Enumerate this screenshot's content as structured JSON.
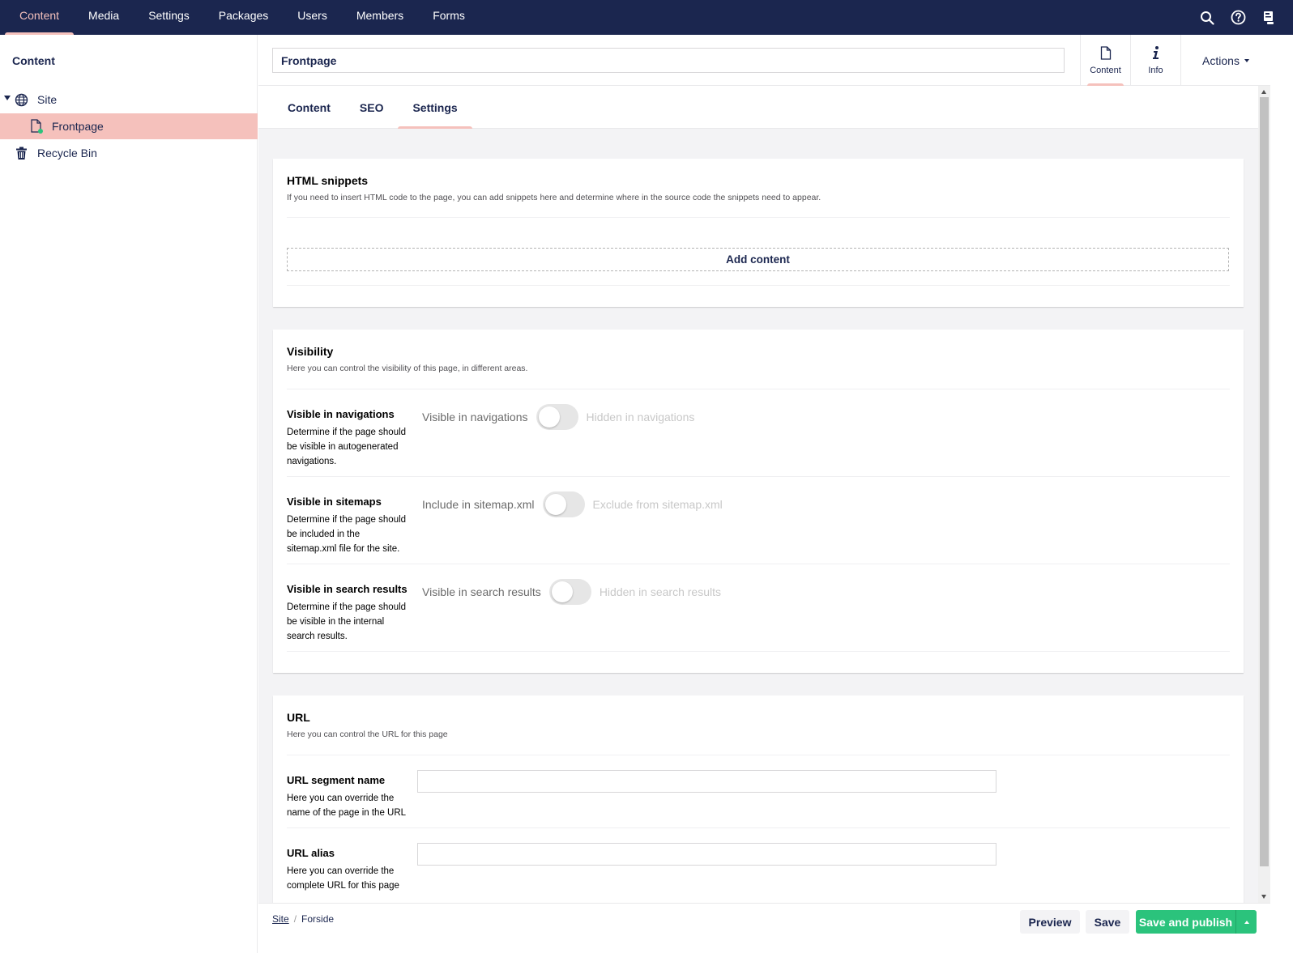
{
  "topnav": {
    "items": [
      {
        "label": "Content",
        "active": true
      },
      {
        "label": "Media"
      },
      {
        "label": "Settings"
      },
      {
        "label": "Packages"
      },
      {
        "label": "Users"
      },
      {
        "label": "Members"
      },
      {
        "label": "Forms"
      }
    ],
    "icons": [
      "search-icon",
      "help-icon",
      "user-avatar-icon"
    ]
  },
  "sidebar": {
    "title": "Content",
    "tree": [
      {
        "label": "Site",
        "icon": "globe-icon",
        "expanded": true
      },
      {
        "label": "Frontpage",
        "icon": "document-icon",
        "selected": true
      },
      {
        "label": "Recycle Bin",
        "icon": "trash-icon"
      }
    ]
  },
  "header": {
    "name_value": "Frontpage",
    "apps": [
      {
        "label": "Content",
        "icon": "document-icon",
        "active": true
      },
      {
        "label": "Info",
        "icon": "info-icon"
      }
    ],
    "actions_label": "Actions"
  },
  "tabs": [
    {
      "label": "Content"
    },
    {
      "label": "SEO"
    },
    {
      "label": "Settings",
      "active": true
    }
  ],
  "panels": {
    "html_snippets": {
      "title": "HTML snippets",
      "description": "If you need to insert HTML code to the page, you can add snippets here and determine where in the source code the snippets need to appear.",
      "add_content_label": "Add content"
    },
    "visibility": {
      "title": "Visibility",
      "description": "Here you can control the visibility of this page, in different areas.",
      "properties": [
        {
          "label": "Visible in navigations",
          "description": "Determine if the page should be visible in autogenerated navigations.",
          "on_label": "Visible in navigations",
          "off_label": "Hidden in navigations",
          "value": false
        },
        {
          "label": "Visible in sitemaps",
          "description": "Determine if the page should be included in the sitemap.xml file for the site.",
          "on_label": "Include in sitemap.xml",
          "off_label": "Exclude from sitemap.xml",
          "value": false
        },
        {
          "label": "Visible in search results",
          "description": "Determine if the page should be visible in the internal search results.",
          "on_label": "Visible in search results",
          "off_label": "Hidden in search results",
          "value": false
        }
      ]
    },
    "url": {
      "title": "URL",
      "description": "Here you can control the URL for this page",
      "properties": [
        {
          "label": "URL segment name",
          "description": "Here you can override the name of the page in the URL",
          "value": ""
        },
        {
          "label": "URL alias",
          "description": "Here you can override the complete URL for this page",
          "value": ""
        }
      ]
    }
  },
  "footer": {
    "breadcrumb": [
      "Site",
      "Forside"
    ],
    "preview_label": "Preview",
    "save_label": "Save",
    "publish_label": "Save and publish"
  },
  "colors": {
    "nav_bg": "#1b264f",
    "accent": "#f5c1bc",
    "publish": "#2bc37c"
  }
}
